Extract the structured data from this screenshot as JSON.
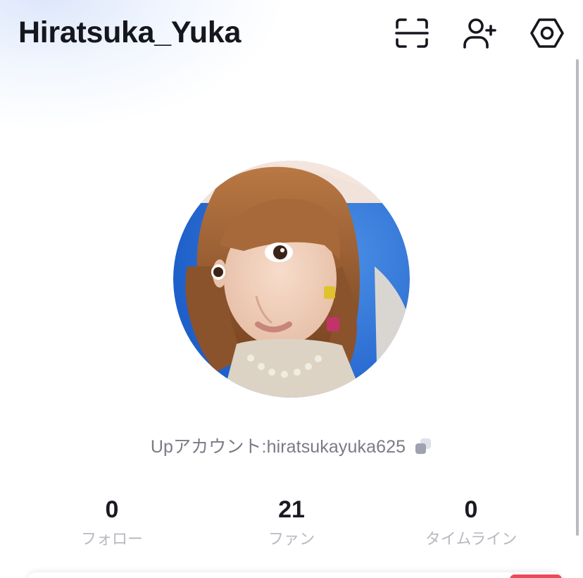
{
  "header": {
    "username": "Hiratsuka_Yuka",
    "icons": {
      "scan": "scan-icon",
      "add_user": "add-user-icon",
      "settings": "settings-icon"
    }
  },
  "profile": {
    "avatar_alt": "profile photo",
    "account_text": "Upアカウント:hiratsukayuka625",
    "copy_icon": "copy-icon"
  },
  "stats": [
    {
      "value": "0",
      "label": "フォロー"
    },
    {
      "value": "21",
      "label": "ファン"
    },
    {
      "value": "0",
      "label": "タイムライン"
    }
  ],
  "colors": {
    "text_primary": "#1a1a22",
    "text_secondary": "#7a7b85",
    "text_muted": "#b8b9c1",
    "accent_red": "#ec4a57"
  }
}
